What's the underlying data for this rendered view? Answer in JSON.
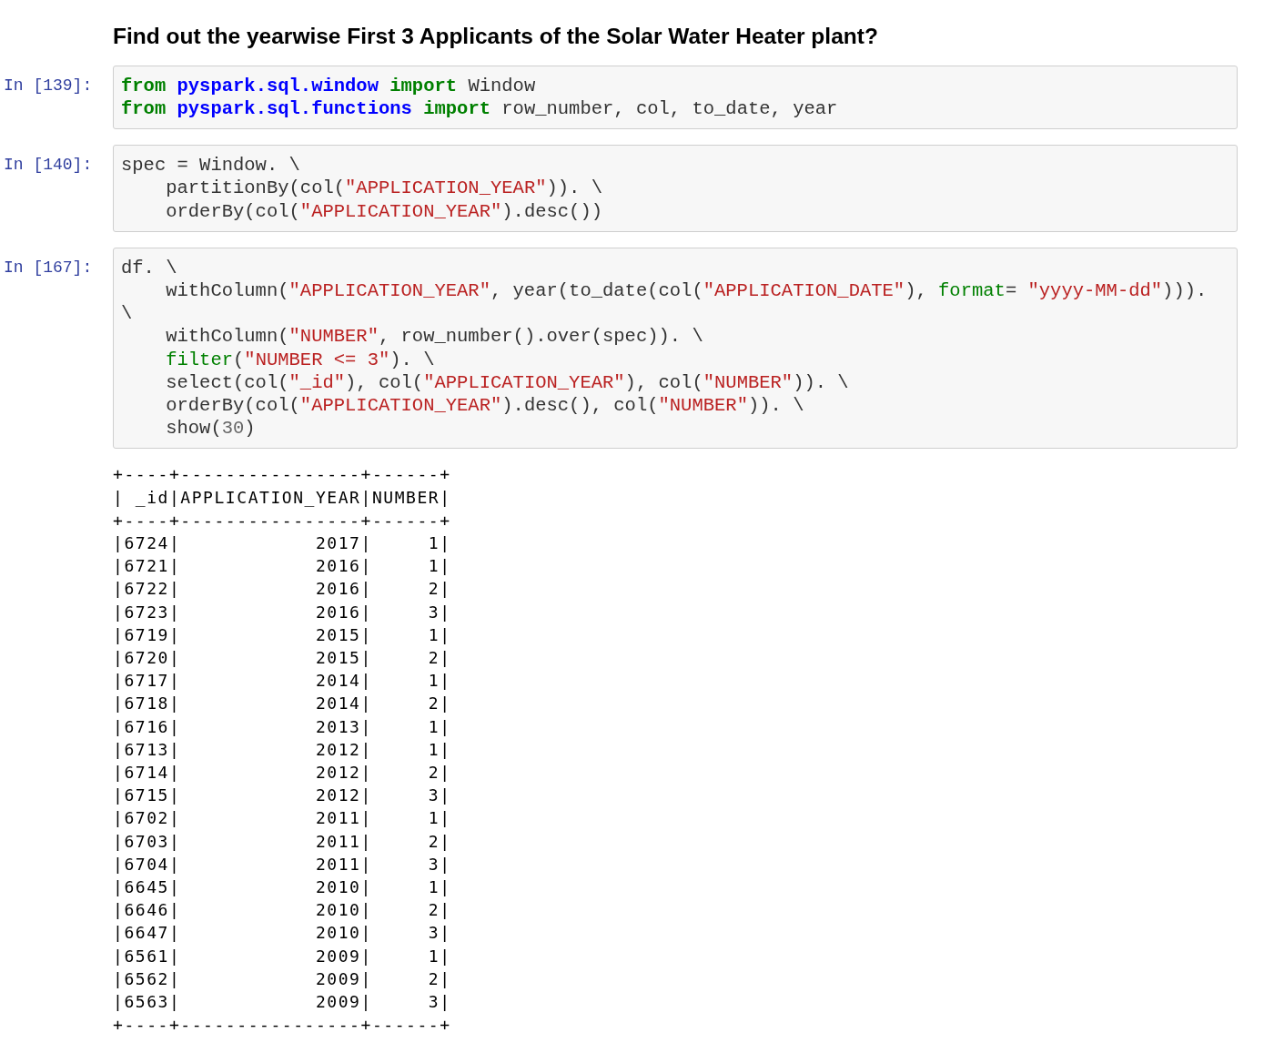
{
  "heading": "Find out the yearwise First 3 Applicants of the Solar Water Heater plant?",
  "cells": [
    {
      "prompt": "In [139]:",
      "lines": [
        [
          {
            "kind": "kw",
            "text": "from "
          },
          {
            "kind": "mod",
            "text": "pyspark.sql.window "
          },
          {
            "kind": "kw",
            "text": "import"
          },
          {
            "kind": "plain",
            "text": " Window"
          }
        ],
        [
          {
            "kind": "kw",
            "text": "from "
          },
          {
            "kind": "mod",
            "text": "pyspark.sql.functions "
          },
          {
            "kind": "kw",
            "text": "import"
          },
          {
            "kind": "plain",
            "text": " row_number, col, to_date, year"
          }
        ]
      ]
    },
    {
      "prompt": "In [140]:",
      "lines": [
        [
          {
            "kind": "plain",
            "text": "spec = Window. \\"
          }
        ],
        [
          {
            "kind": "plain",
            "text": "    partitionBy(col("
          },
          {
            "kind": "str",
            "text": "\"APPLICATION_YEAR\""
          },
          {
            "kind": "plain",
            "text": ")). \\"
          }
        ],
        [
          {
            "kind": "plain",
            "text": "    orderBy(col("
          },
          {
            "kind": "str",
            "text": "\"APPLICATION_YEAR\""
          },
          {
            "kind": "plain",
            "text": ").desc())"
          }
        ]
      ]
    },
    {
      "prompt": "In [167]:",
      "lines": [
        [
          {
            "kind": "plain",
            "text": "df. \\"
          }
        ],
        [
          {
            "kind": "plain",
            "text": "    withColumn("
          },
          {
            "kind": "str",
            "text": "\"APPLICATION_YEAR\""
          },
          {
            "kind": "plain",
            "text": ", year(to_date(col("
          },
          {
            "kind": "str",
            "text": "\"APPLICATION_DATE\""
          },
          {
            "kind": "plain",
            "text": "), "
          },
          {
            "kind": "builtin",
            "text": "format"
          },
          {
            "kind": "plain",
            "text": "= "
          },
          {
            "kind": "str",
            "text": "\"yyyy-MM-dd\""
          },
          {
            "kind": "plain",
            "text": ")))."
          }
        ],
        [
          {
            "kind": "plain",
            "text": "\\"
          }
        ],
        [
          {
            "kind": "plain",
            "text": "    withColumn("
          },
          {
            "kind": "str",
            "text": "\"NUMBER\""
          },
          {
            "kind": "plain",
            "text": ", row_number().over(spec)). \\"
          }
        ],
        [
          {
            "kind": "builtin",
            "text": "    filter"
          },
          {
            "kind": "plain",
            "text": "("
          },
          {
            "kind": "str",
            "text": "\"NUMBER <= 3\""
          },
          {
            "kind": "plain",
            "text": "). \\"
          }
        ],
        [
          {
            "kind": "plain",
            "text": "    select(col("
          },
          {
            "kind": "str",
            "text": "\"_id\""
          },
          {
            "kind": "plain",
            "text": "), col("
          },
          {
            "kind": "str",
            "text": "\"APPLICATION_YEAR\""
          },
          {
            "kind": "plain",
            "text": "), col("
          },
          {
            "kind": "str",
            "text": "\"NUMBER\""
          },
          {
            "kind": "plain",
            "text": ")). \\"
          }
        ],
        [
          {
            "kind": "plain",
            "text": "    orderBy(col("
          },
          {
            "kind": "str",
            "text": "\"APPLICATION_YEAR\""
          },
          {
            "kind": "plain",
            "text": ").desc(), col("
          },
          {
            "kind": "str",
            "text": "\"NUMBER\""
          },
          {
            "kind": "plain",
            "text": ")). \\"
          }
        ],
        [
          {
            "kind": "plain",
            "text": "    show("
          },
          {
            "kind": "num",
            "text": "30"
          },
          {
            "kind": "plain",
            "text": ")"
          }
        ]
      ]
    }
  ],
  "output": [
    "+----+----------------+------+",
    "| _id|APPLICATION_YEAR|NUMBER|",
    "+----+----------------+------+",
    "|6724|            2017|     1|",
    "|6721|            2016|     1|",
    "|6722|            2016|     2|",
    "|6723|            2016|     3|",
    "|6719|            2015|     1|",
    "|6720|            2015|     2|",
    "|6717|            2014|     1|",
    "|6718|            2014|     2|",
    "|6716|            2013|     1|",
    "|6713|            2012|     1|",
    "|6714|            2012|     2|",
    "|6715|            2012|     3|",
    "|6702|            2011|     1|",
    "|6703|            2011|     2|",
    "|6704|            2011|     3|",
    "|6645|            2010|     1|",
    "|6646|            2010|     2|",
    "|6647|            2010|     3|",
    "|6561|            2009|     1|",
    "|6562|            2009|     2|",
    "|6563|            2009|     3|",
    "+----+----------------+------+"
  ]
}
